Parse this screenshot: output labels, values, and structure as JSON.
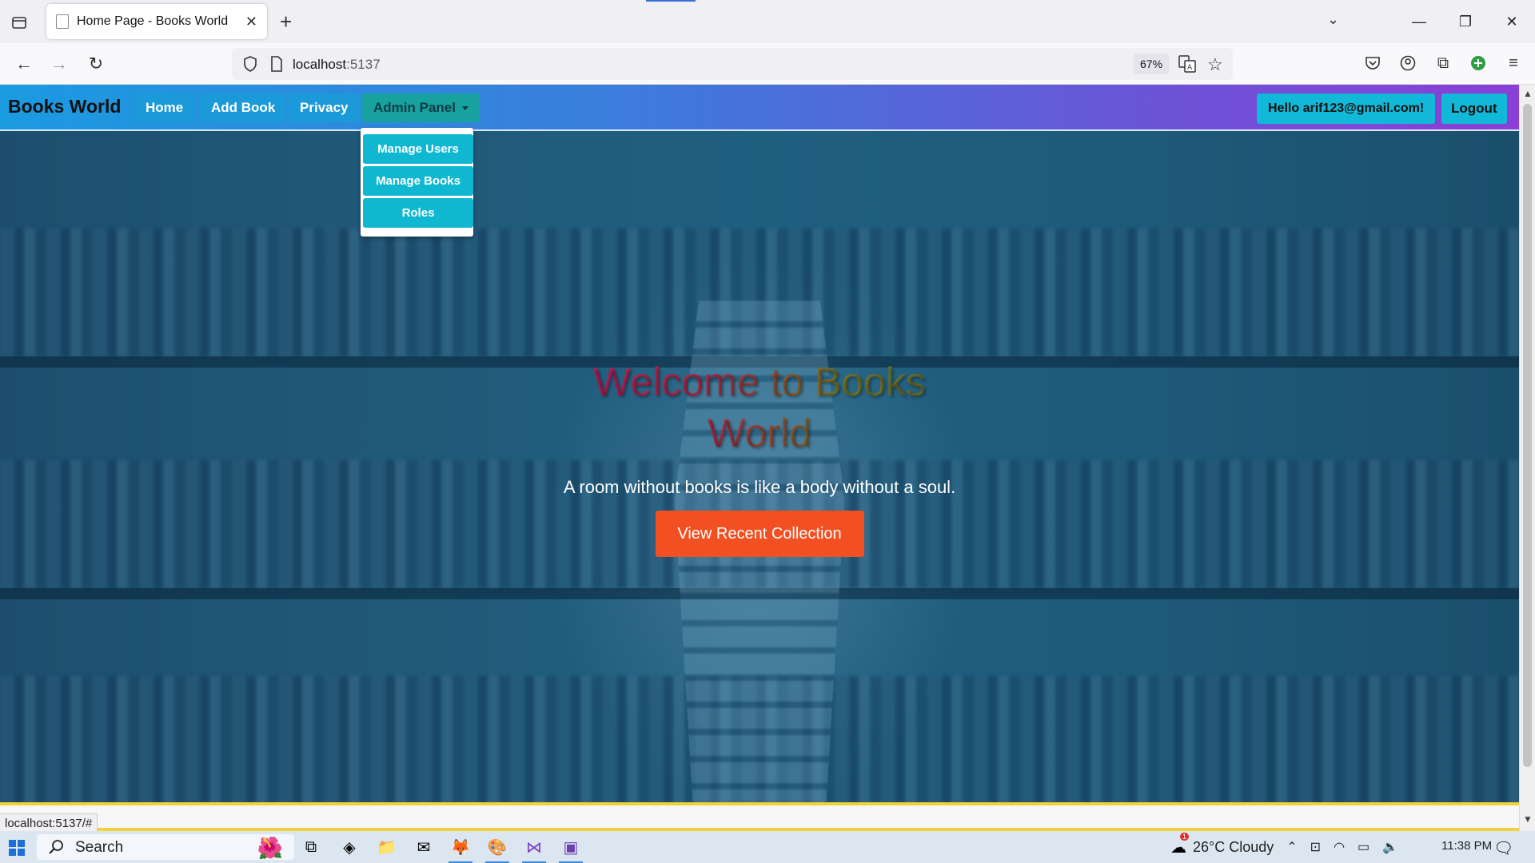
{
  "browser": {
    "tab_title": "Home Page - Books World",
    "url_host": "localhost",
    "url_port": ":5137",
    "zoom": "67%",
    "status_url": "localhost:5137/#"
  },
  "site": {
    "brand": "Books World",
    "nav": {
      "home": "Home",
      "add_book": "Add Book",
      "privacy": "Privacy",
      "admin_panel": "Admin Panel"
    },
    "admin_menu": [
      "Manage Users",
      "Manage Books",
      "Roles"
    ],
    "user_greeting": "Hello arif123@gmail.com!",
    "logout": "Logout"
  },
  "hero": {
    "title": "Welcome to Books World",
    "tagline": "A room without books is like a body without a soul.",
    "cta": "View Recent Collection"
  },
  "taskbar": {
    "search_label": "Search",
    "weather": "26°C  Cloudy",
    "weather_badge": "1",
    "time": "11:38 PM"
  },
  "colors": {
    "nav_gradient_start": "#1a9be0",
    "nav_gradient_end": "#8a3fd6",
    "button_cyan": "#12b8d8",
    "cta_orange": "#f25022"
  }
}
